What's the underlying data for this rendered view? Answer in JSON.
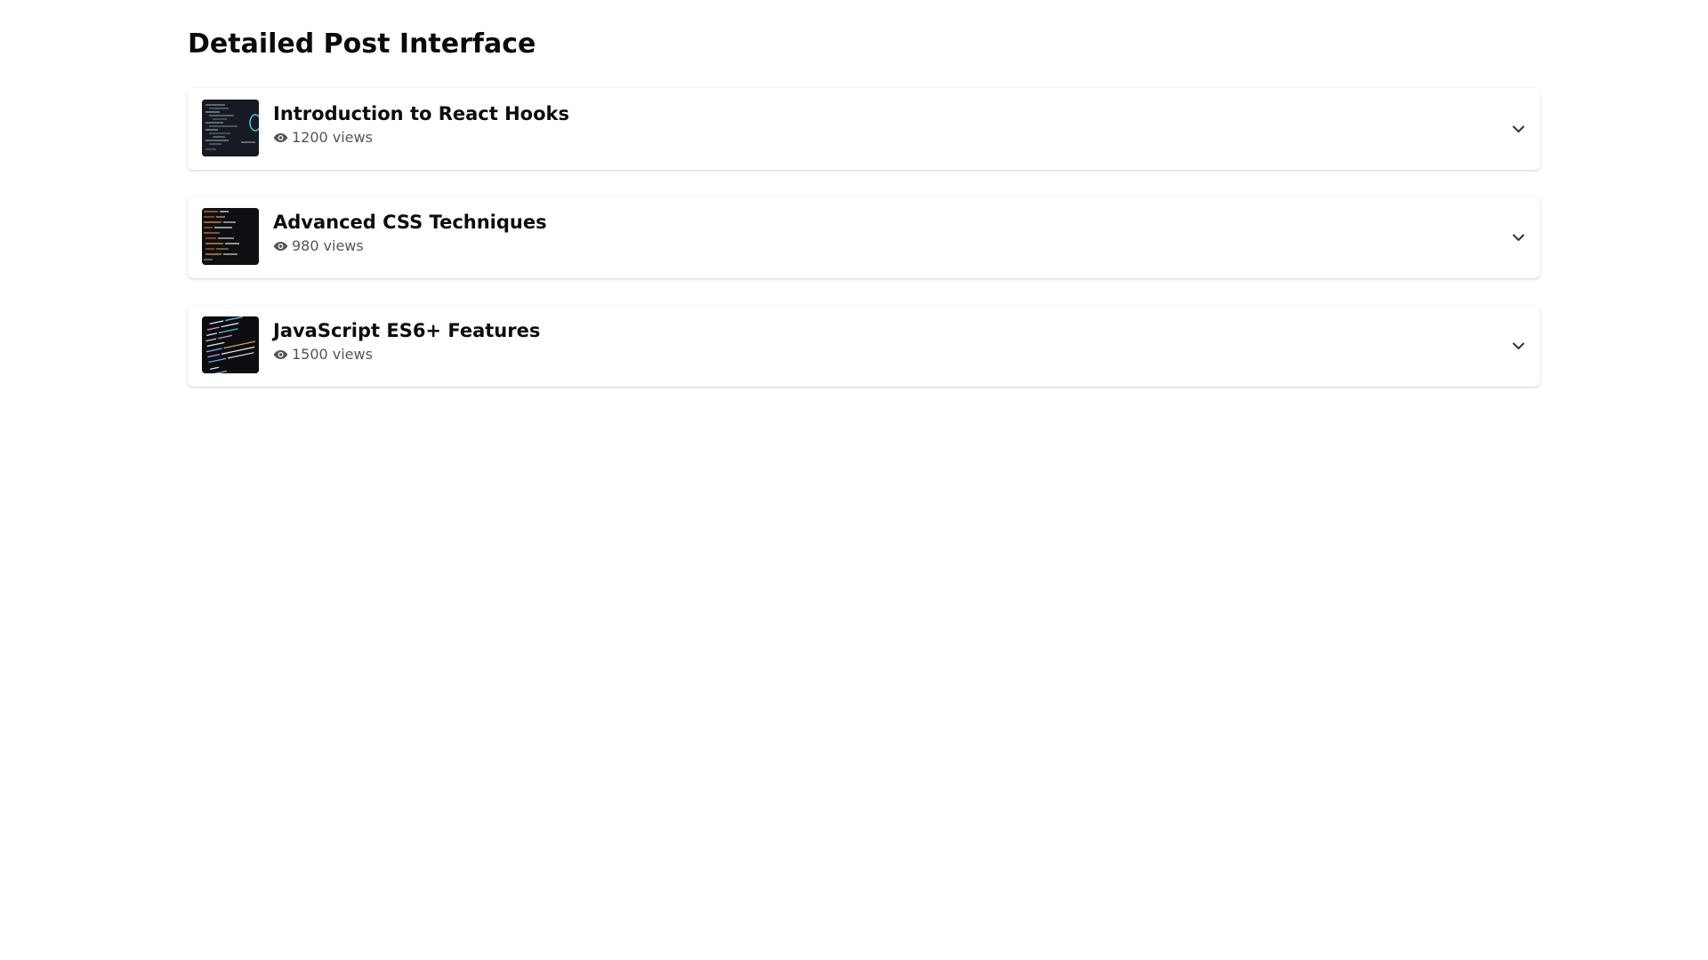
{
  "page": {
    "title": "Detailed Post Interface"
  },
  "posts": [
    {
      "title": "Introduction to React Hooks",
      "views": "1200",
      "views_label": "views",
      "thumbnail": "react-code-image"
    },
    {
      "title": "Advanced CSS Techniques",
      "views": "980",
      "views_label": "views",
      "thumbnail": "css-code-image"
    },
    {
      "title": "JavaScript ES6+ Features",
      "views": "1500",
      "views_label": "views",
      "thumbnail": "js-code-image"
    }
  ],
  "icons": {
    "views": "eye-icon",
    "expand": "chevron-down-icon"
  },
  "colors": {
    "title_text": "#0d0d0d",
    "meta_text": "#555555",
    "card_bg": "#ffffff"
  }
}
